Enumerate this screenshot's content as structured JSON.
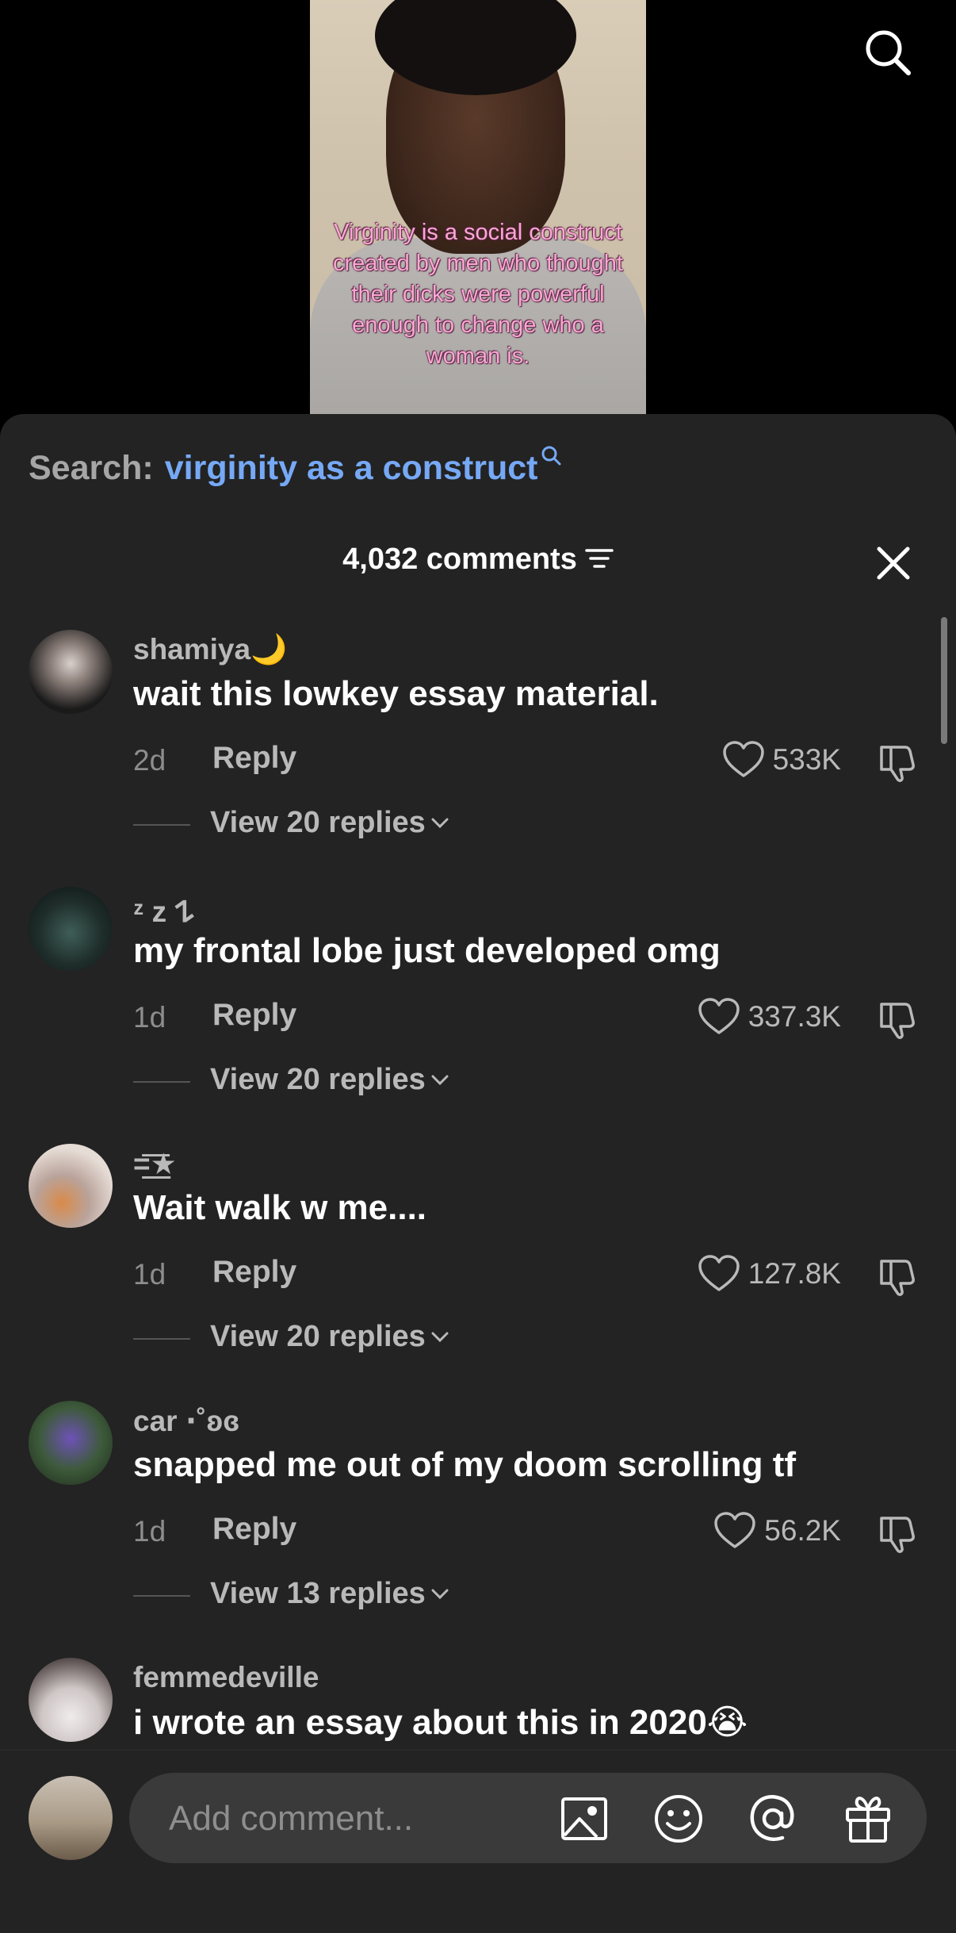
{
  "video": {
    "caption": "Virginity is a social construct created by men who thought their dicks were powerful enough to change who a woman is.",
    "search_icon": "search-icon"
  },
  "search_suggestion": {
    "label": "Search:",
    "query": "virginity as a construct"
  },
  "comments_header": {
    "count_label": "4,032 comments"
  },
  "comments": [
    {
      "username": "shamiya🌙",
      "text": "wait this lowkey essay material.",
      "time": "2d",
      "reply_label": "Reply",
      "likes": "533K",
      "view_replies": "View 20 replies"
    },
    {
      "username": "ᶻ z 𐰁",
      "text": "my frontal lobe just developed omg",
      "time": "1d",
      "reply_label": "Reply",
      "likes": "337.3K",
      "view_replies": "View 20 replies"
    },
    {
      "username": "=͟͟͞͞★",
      "text": "Wait walk w me....",
      "time": "1d",
      "reply_label": "Reply",
      "likes": "127.8K",
      "view_replies": "View 20 replies"
    },
    {
      "username": "car ⋅˚ʚɞ",
      "text": "snapped me out of my doom scrolling tf",
      "time": "1d",
      "reply_label": "Reply",
      "likes": "56.2K",
      "view_replies": "View 13 replies"
    },
    {
      "username": "femmedeville",
      "text": "i wrote an essay about this in 2020😭"
    }
  ],
  "composer": {
    "placeholder": "Add comment..."
  },
  "colors": {
    "sheet_bg": "#232323",
    "link_blue": "#76a9f5",
    "caption_pink": "#f9a8d4"
  }
}
